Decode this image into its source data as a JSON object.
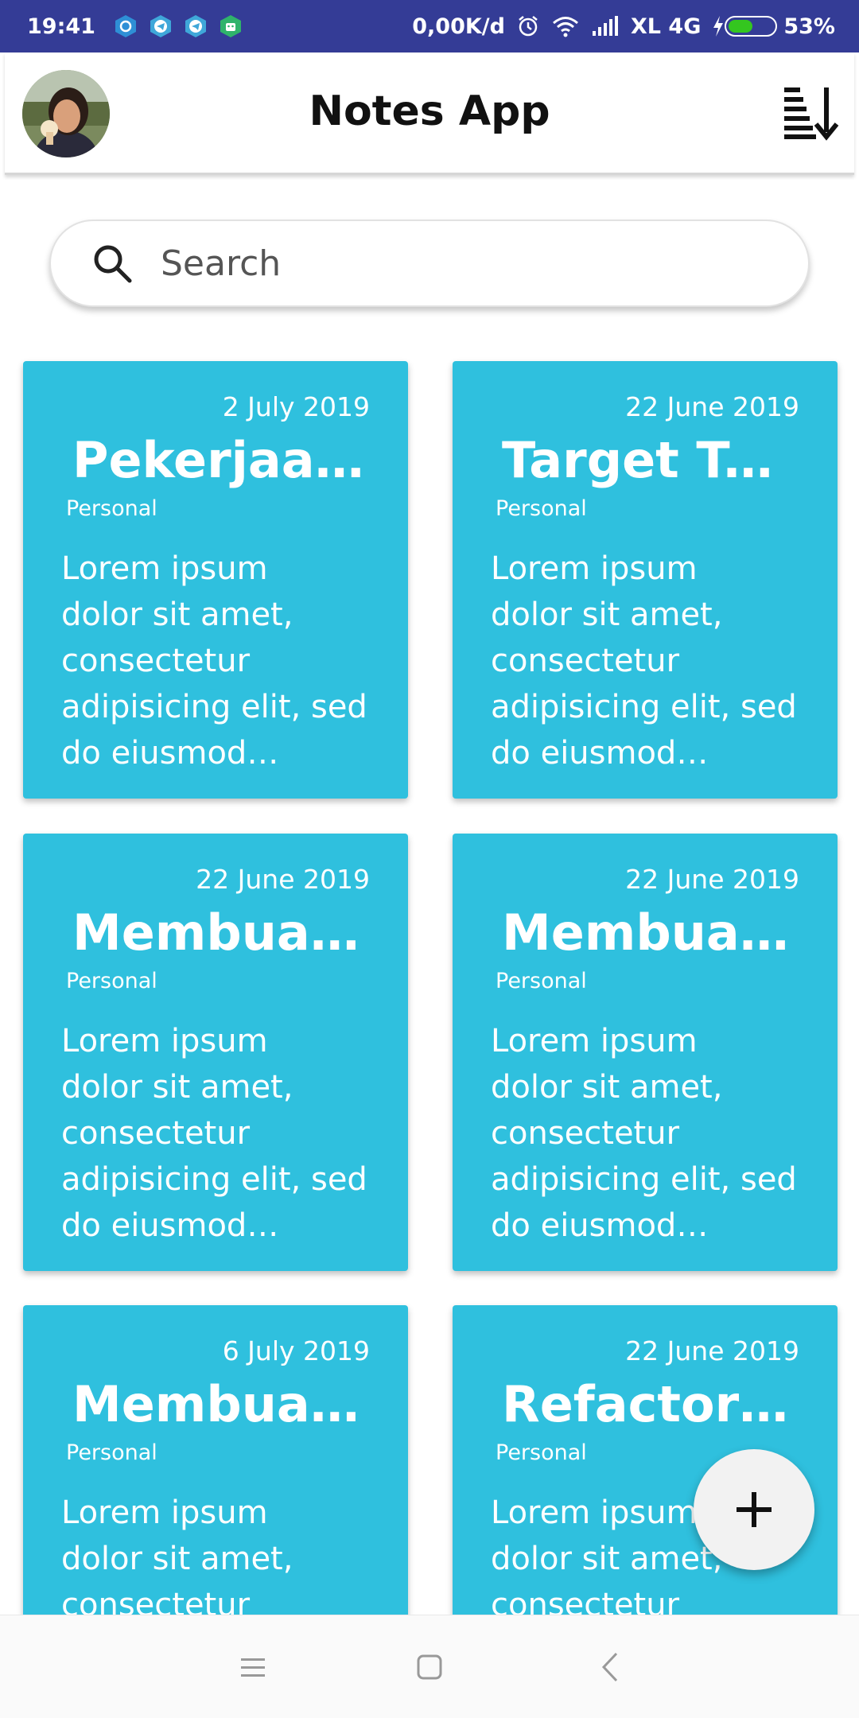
{
  "status_bar": {
    "time": "19:41",
    "net_speed": "0,00K/d",
    "carrier": "XL 4G",
    "battery": "53%",
    "battery_level": 0.53,
    "icons": [
      "shield-icon",
      "telegram-icon",
      "telegram-icon",
      "android-icon",
      "alarm-icon",
      "wifi-icon",
      "signal-icon",
      "charging-icon",
      "battery-icon"
    ]
  },
  "app_bar": {
    "title": "Notes App",
    "avatar_icon": "profile-avatar",
    "sort_icon": "sort-descending-icon"
  },
  "search": {
    "placeholder": "Search",
    "icon": "search-icon"
  },
  "notes": [
    {
      "date": "2 July 2019",
      "title": "Pekerjaan…",
      "category": "Personal",
      "body": " Lorem ipsum\ndolor sit amet,\nconsectetur\nadipisicing elit, sed\ndo eiusmod…"
    },
    {
      "date": "22 June 2019",
      "title": "Target Tahu..",
      "category": "Personal",
      "body": " Lorem ipsum\ndolor sit amet,\nconsectetur\nadipisicing elit, sed\ndo eiusmod…"
    },
    {
      "date": "22 June 2019",
      "title": "Membuat C…",
      "category": "Personal",
      "body": " Lorem ipsum\ndolor sit amet,\nconsectetur\nadipisicing elit, sed\ndo eiusmod…"
    },
    {
      "date": "22 June 2019",
      "title": "Membuat M..",
      "category": "Personal",
      "body": " Lorem ipsum\ndolor sit amet,\nconsectetur\nadipisicing elit, sed\ndo eiusmod…"
    },
    {
      "date": "6 July 2019",
      "title": "Membuat d…",
      "category": "Personal",
      "body": " Lorem ipsum\ndolor sit amet,\nconsectetur\nadipisicing elit, sed\ndo eiusmod…"
    },
    {
      "date": "22 June 2019",
      "title": "Refactoring…",
      "category": "Personal",
      "body": " Lorem ipsum\ndolor sit amet,\nconsectetur\nadipisicing elit, sed\ndo eiusmod…"
    }
  ],
  "fab": {
    "icon": "plus-icon"
  },
  "nav_bar": {
    "icons": [
      "menu-icon",
      "home-icon",
      "back-icon"
    ]
  },
  "colors": {
    "status_bar": "#343c96",
    "note_card": "#2fc0de",
    "fab": "#f2f2f2",
    "battery_fill": "#34c61f"
  }
}
